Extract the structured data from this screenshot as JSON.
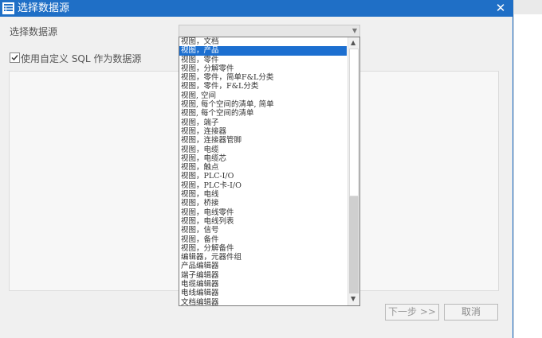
{
  "window": {
    "title": "选择数据源",
    "close_glyph": "✕"
  },
  "form": {
    "source_label": "选择数据源",
    "combo_value": "",
    "use_sql_label": "使用自定义 SQL 作为数据源",
    "use_sql_checked": true
  },
  "buttons": {
    "next": "下一步 >>",
    "cancel": "取消"
  },
  "dropdown": {
    "selected_index": 1,
    "items": [
      "视图，文档",
      "视图，产品",
      "视图，零件",
      "视图，分解零件",
      "视图，零件，简单F&L分类",
      "视图，零件，F&L分类",
      "视图, 空间",
      "视图, 每个空间的清单, 简单",
      "视图, 每个空间的清单",
      "视图，端子",
      "视图，连接器",
      "视图，连接器管脚",
      "视图，电缆",
      "视图，电缆芯",
      "视图，触点",
      "视图，PLC-I/O",
      "视图，PLC卡-I/O",
      "视图，电线",
      "视图，桥接",
      "视图，电线零件",
      "视图，电线列表",
      "视图，信号",
      "视图，备件",
      "视图，分解备件",
      "编辑器，元器件组",
      "产品编辑器",
      "端子编辑器",
      "电缆编辑器",
      "电线编辑器",
      "文档编辑器"
    ]
  }
}
